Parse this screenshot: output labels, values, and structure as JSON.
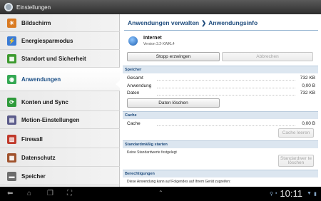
{
  "window": {
    "title": "Einstellungen"
  },
  "sidebar": {
    "items": [
      {
        "label": "Bildschirm",
        "icon": "display-icon",
        "color": "#d97a22",
        "glyph": "☀"
      },
      {
        "label": "Energiesparmodus",
        "icon": "power-saving-icon",
        "color": "#3a7bd5",
        "glyph": "⚡"
      },
      {
        "label": "Standort und Sicherheit",
        "icon": "location-security-icon",
        "color": "#3c9a2e",
        "glyph": "▦"
      },
      {
        "label": "Anwendungen",
        "icon": "applications-icon",
        "color": "#34a853",
        "glyph": "◉"
      },
      {
        "label": "Konten und Sync",
        "icon": "accounts-sync-icon",
        "color": "#2e9a3a",
        "glyph": "⟳"
      },
      {
        "label": "Motion-Einstellungen",
        "icon": "motion-icon",
        "color": "#5a5a8a",
        "glyph": "▤"
      },
      {
        "label": "Firewall",
        "icon": "firewall-icon",
        "color": "#c0392b",
        "glyph": "▥"
      },
      {
        "label": "Datenschutz",
        "icon": "privacy-icon",
        "color": "#a0522d",
        "glyph": "▦"
      },
      {
        "label": "Speicher",
        "icon": "storage-icon",
        "color": "#6d6d6d",
        "glyph": "▬"
      }
    ],
    "active_index": 3
  },
  "main": {
    "breadcrumb": {
      "parent": "Anwendungen verwalten",
      "separator": "❯",
      "current": "Anwendungsinfo"
    },
    "app": {
      "name": "Internet",
      "version": "Version 3.2-XWKL4"
    },
    "buttons": {
      "force_stop": "Stopp erzwingen",
      "uninstall": "Abbrechen",
      "clear_data": "Daten löschen",
      "clear_cache": "Cache leeren",
      "clear_defaults": "Standardwer te löschen"
    },
    "storage": {
      "header": "Speicher",
      "rows": [
        {
          "label": "Gesamt",
          "value": "732 KB"
        },
        {
          "label": "Anwendung",
          "value": "0,00 B"
        },
        {
          "label": "Daten",
          "value": "732 KB"
        }
      ]
    },
    "cache": {
      "header": "Cache",
      "label": "Cache",
      "value": "0,00 B"
    },
    "defaults": {
      "header": "Standardmäßig starten",
      "note": "Keine Standardwerte festgelegt"
    },
    "permissions": {
      "header": "Berechtigungen",
      "note": "Diese Anwendung kann auf Folgendes auf Ihrem Gerät zugreifen:"
    }
  },
  "systembar": {
    "time": "10:11"
  }
}
